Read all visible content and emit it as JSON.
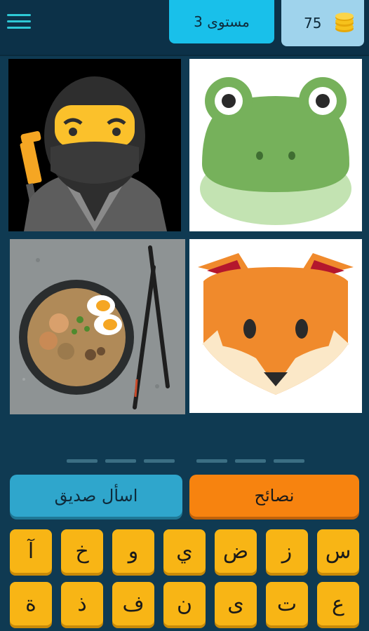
{
  "header": {
    "level_label": "مستوى 3",
    "coins": "75",
    "menu_icon": "hamburger-menu-icon",
    "coins_icon": "coin-stack-icon"
  },
  "images": [
    {
      "name": "ninja-image",
      "description": "ninja emoji"
    },
    {
      "name": "frog-image",
      "description": "frog face"
    },
    {
      "name": "ramen-image",
      "description": "ramen bowl with chopsticks"
    },
    {
      "name": "fox-image",
      "description": "fox face"
    }
  ],
  "answer": {
    "slots": 6
  },
  "buttons": {
    "ask_friend": "اسأل صديق",
    "tips": "نصائح"
  },
  "keyboard": {
    "row1": [
      "آ",
      "خ",
      "و",
      "ي",
      "ض",
      "ز",
      "س"
    ],
    "row2": [
      "ة",
      "ذ",
      "ف",
      "ن",
      "ى",
      "ت",
      "ع"
    ]
  },
  "colors": {
    "background": "#0f3a52",
    "key": "#f8b515",
    "tips_button": "#f7830f",
    "ask_button": "#2fa6cc",
    "level_badge": "#19c0ea"
  }
}
